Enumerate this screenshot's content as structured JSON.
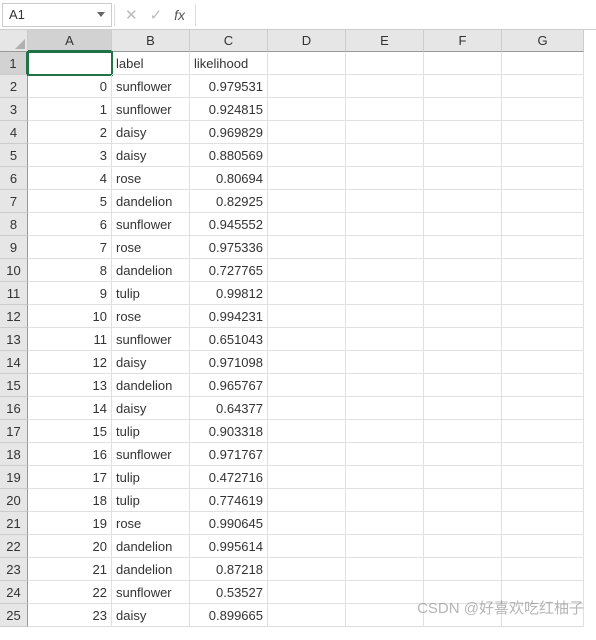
{
  "name_box": {
    "value": "A1"
  },
  "formula_bar": {
    "fx_label": "fx",
    "value": ""
  },
  "columns": [
    "A",
    "B",
    "C",
    "D",
    "E",
    "F",
    "G"
  ],
  "active_col_index": 0,
  "active_row_index": 0,
  "row_numbers": [
    1,
    2,
    3,
    4,
    5,
    6,
    7,
    8,
    9,
    10,
    11,
    12,
    13,
    14,
    15,
    16,
    17,
    18,
    19,
    20,
    21,
    22,
    23,
    24,
    25
  ],
  "sheet": {
    "headers": {
      "b": "label",
      "c": "likelihood"
    },
    "rows": [
      {
        "a": "0",
        "b": "sunflower",
        "c": "0.979531"
      },
      {
        "a": "1",
        "b": "sunflower",
        "c": "0.924815"
      },
      {
        "a": "2",
        "b": "daisy",
        "c": "0.969829"
      },
      {
        "a": "3",
        "b": "daisy",
        "c": "0.880569"
      },
      {
        "a": "4",
        "b": "rose",
        "c": "0.80694"
      },
      {
        "a": "5",
        "b": "dandelion",
        "c": "0.82925"
      },
      {
        "a": "6",
        "b": "sunflower",
        "c": "0.945552"
      },
      {
        "a": "7",
        "b": "rose",
        "c": "0.975336"
      },
      {
        "a": "8",
        "b": "dandelion",
        "c": "0.727765"
      },
      {
        "a": "9",
        "b": "tulip",
        "c": "0.99812"
      },
      {
        "a": "10",
        "b": "rose",
        "c": "0.994231"
      },
      {
        "a": "11",
        "b": "sunflower",
        "c": "0.651043"
      },
      {
        "a": "12",
        "b": "daisy",
        "c": "0.971098"
      },
      {
        "a": "13",
        "b": "dandelion",
        "c": "0.965767"
      },
      {
        "a": "14",
        "b": "daisy",
        "c": "0.64377"
      },
      {
        "a": "15",
        "b": "tulip",
        "c": "0.903318"
      },
      {
        "a": "16",
        "b": "sunflower",
        "c": "0.971767"
      },
      {
        "a": "17",
        "b": "tulip",
        "c": "0.472716"
      },
      {
        "a": "18",
        "b": "tulip",
        "c": "0.774619"
      },
      {
        "a": "19",
        "b": "rose",
        "c": "0.990645"
      },
      {
        "a": "20",
        "b": "dandelion",
        "c": "0.995614"
      },
      {
        "a": "21",
        "b": "dandelion",
        "c": "0.87218"
      },
      {
        "a": "22",
        "b": "sunflower",
        "c": "0.53527"
      },
      {
        "a": "23",
        "b": "daisy",
        "c": "0.899665"
      }
    ]
  },
  "watermark": "CSDN @好喜欢吃红柚子",
  "chart_data": {
    "type": "table",
    "columns": [
      "",
      "label",
      "likelihood"
    ],
    "rows": [
      [
        0,
        "sunflower",
        0.979531
      ],
      [
        1,
        "sunflower",
        0.924815
      ],
      [
        2,
        "daisy",
        0.969829
      ],
      [
        3,
        "daisy",
        0.880569
      ],
      [
        4,
        "rose",
        0.80694
      ],
      [
        5,
        "dandelion",
        0.82925
      ],
      [
        6,
        "sunflower",
        0.945552
      ],
      [
        7,
        "rose",
        0.975336
      ],
      [
        8,
        "dandelion",
        0.727765
      ],
      [
        9,
        "tulip",
        0.99812
      ],
      [
        10,
        "rose",
        0.994231
      ],
      [
        11,
        "sunflower",
        0.651043
      ],
      [
        12,
        "daisy",
        0.971098
      ],
      [
        13,
        "dandelion",
        0.965767
      ],
      [
        14,
        "daisy",
        0.64377
      ],
      [
        15,
        "tulip",
        0.903318
      ],
      [
        16,
        "sunflower",
        0.971767
      ],
      [
        17,
        "tulip",
        0.472716
      ],
      [
        18,
        "tulip",
        0.774619
      ],
      [
        19,
        "rose",
        0.990645
      ],
      [
        20,
        "dandelion",
        0.995614
      ],
      [
        21,
        "dandelion",
        0.87218
      ],
      [
        22,
        "sunflower",
        0.53527
      ],
      [
        23,
        "daisy",
        0.899665
      ]
    ]
  }
}
